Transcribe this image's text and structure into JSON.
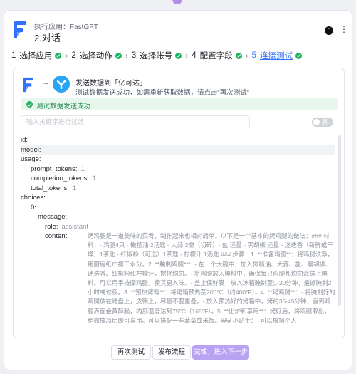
{
  "header": {
    "subtitle": "执行应用：FastGPT",
    "title": "2.对话"
  },
  "steps": [
    {
      "num": "1",
      "label": "选择应用",
      "done": true
    },
    {
      "num": "2",
      "label": "选择动作",
      "done": true
    },
    {
      "num": "3",
      "label": "选择账号",
      "done": true
    },
    {
      "num": "4",
      "label": "配置字段",
      "done": true
    },
    {
      "num": "5",
      "label": "连接测试",
      "done": true,
      "active": true
    }
  ],
  "panel": {
    "title": "发送数据到「亿可达」",
    "description": "测试数据发送成功，如需重新获取数据，请点击“再次测试”",
    "success_text": "测试数据发送成功",
    "filter_placeholder": "输入关键字进行过滤",
    "toggle_label": "原"
  },
  "tree": {
    "id": "id:",
    "model": "model:",
    "usage": "usage:",
    "prompt_tokens_key": "prompt_tokens:",
    "prompt_tokens_val": "1",
    "completion_tokens_key": "completion_tokens:",
    "completion_tokens_val": "1",
    "total_tokens_key": "total_tokens:",
    "total_tokens_val": "1",
    "choices": "choices:",
    "index0": "0:",
    "message": "message:",
    "role_key": "role:",
    "role_val": "assistant",
    "content_key": "content:",
    "content_val": "烤鸡腿是一道美味的菜肴，制作起来也相对简单。以下是一个基本的烤鸡腿的做法：### 材料：- 鸡腿4只 - 橄榄油 2汤匙 - 大蒜 3瓣（切碎）- 盐 适量 - 黑胡椒 适量 - 迷迭香（新鲜或干燥）1茶匙 - 红椒粉（可选）1茶匙 - 柠檬汁 1汤匙 ### 步骤：1. **准备鸡腿**：将鸡腿洗净，用厨房纸巾擦干水分。2. **腌制鸡腿**：- 在一个大碗中，加入橄榄油、大蒜、盐、黑胡椒、迷迭香、红椒粉和柠檬汁，搅拌均匀。- 将鸡腿放入腌料中，确保每只鸡腿都均匀涂抹上腌料。可以用手按摩鸡腿，使其更入味。- 盖上保鲜膜，放入冰箱腌制至少30分钟，最好腌制2小时或过夜。3. **预热烤箱**：将烤箱预热至200°C（约400°F）。4. **烤鸡腿**：- 将腌制好的鸡腿放在烤盘上，皮朝上，尽量不要重叠。- 放入预热好的烤箱中，烤约35-45分钟，直到鸡腿表面金黄酥脆，内部温度达到75°C（165°F）。5. **出炉和享用**：烤好后，将鸡腿取出，稍微放凉后即可享用。可以搭配一些蔬菜或米饭。### 小贴士：- 可以根据个人"
  },
  "buttons": {
    "retest": "再次测试",
    "publish": "发布流程",
    "next": "完成，进入下一步"
  },
  "colors": {
    "accent": "#3370ff",
    "success": "#22b35e",
    "primary_button": "#b7a3f2"
  }
}
